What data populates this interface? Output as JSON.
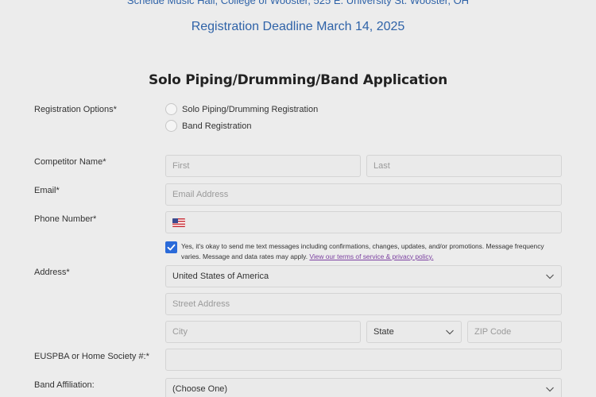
{
  "header": {
    "venue": "Scheide Music Hall, College of Wooster, 525 E. University St. Wooster, OH",
    "deadline": "Registration Deadline March 14, 2025",
    "form_title": "Solo Piping/Drumming/Band Application"
  },
  "registration_options": {
    "label": "Registration Options",
    "required_mark": "*",
    "options": [
      "Solo Piping/Drumming Registration",
      "Band Registration"
    ]
  },
  "competitor_name": {
    "label": "Competitor Name",
    "required_mark": "*",
    "first_placeholder": "First",
    "last_placeholder": "Last"
  },
  "email": {
    "label": "Email",
    "required_mark": "*",
    "placeholder": "Email Address"
  },
  "phone": {
    "label": "Phone Number",
    "required_mark": "*",
    "flag_icon": "us-flag-icon",
    "value": ""
  },
  "sms_consent": {
    "checked": true,
    "text": "Yes, it's okay to send me text messages including confirmations, changes, updates, and/or promotions. Message frequency varies. Message and data rates may apply.",
    "link_text": "View our terms of service & privacy policy."
  },
  "address": {
    "label": "Address",
    "required_mark": "*",
    "country_value": "United States of America",
    "street_placeholder": "Street Address",
    "city_placeholder": "City",
    "state_value": "State",
    "zip_placeholder": "ZIP Code"
  },
  "society": {
    "label": "EUSPBA or Home Society #:",
    "required_mark": "*",
    "value": ""
  },
  "band_affiliation": {
    "label": "Band Affiliation:",
    "value": "(Choose One)"
  },
  "colors": {
    "accent_blue": "#2f63a8",
    "checkbox_blue": "#2a6ad9",
    "link_purple": "#7b3fa0",
    "page_bg": "#ececec"
  }
}
